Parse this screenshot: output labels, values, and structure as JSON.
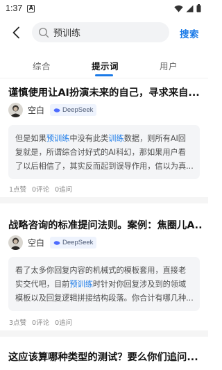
{
  "status": {
    "time": "1:37",
    "icons": [
      "a-notification-icon",
      "wifi-icon",
      "signal-icon",
      "battery-icon"
    ]
  },
  "header": {
    "search_value": "预训练",
    "search_button": "搜索"
  },
  "tabs": [
    {
      "label": "综合",
      "active": false
    },
    {
      "label": "提示词",
      "active": true
    },
    {
      "label": "用户",
      "active": false
    }
  ],
  "colors": {
    "accent": "#1a7ae8",
    "excerpt_bg": "#f4f5f7",
    "badge_bg": "#eef3fd"
  },
  "posts": [
    {
      "title": "谨慎使用让AI扮演未来的自己，寻求来自...",
      "author": "空白",
      "model": "DeepSeek",
      "excerpt": [
        {
          "a": "但是如果",
          "hl": "预训练",
          "b": "中没有此类",
          "hl2": "训练",
          "c": "数据，则所有AI回"
        },
        {
          "a": "复就是，所谓综合讨好式的AI科幻，那如果用户看"
        },
        {
          "a": "了以后相信了，其实反而起到误导作用，信以为真..."
        }
      ],
      "stats": {
        "likes": "1点赞",
        "comments": "0评论",
        "followups": "0追问"
      }
    },
    {
      "title": "战略咨询的标准提问法则。案例：焦圈儿A...",
      "author": "空白",
      "model": "DeepSeek",
      "excerpt": [
        {
          "a": "看了太多你回复内容的机械式的模板套用，直接老"
        },
        {
          "a": "实交代吧，目前",
          "hl": "预训练",
          "b": "时针对你回复涉及到的领域"
        },
        {
          "a": "模板以及回复逻辑拼接结构段落。你合计有哪几种..."
        }
      ],
      "stats": {
        "likes": "3点赞",
        "comments": "0评论",
        "followups": "0追问"
      }
    },
    {
      "title": "这应该算哪种类型的测试？要么你们追问..."
    }
  ]
}
